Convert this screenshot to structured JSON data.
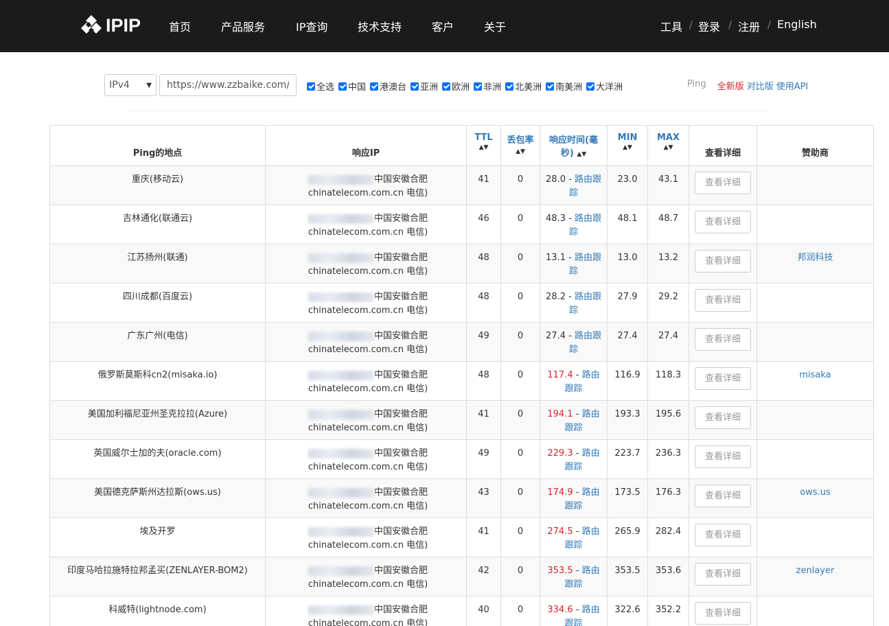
{
  "header": {
    "logo_text": "IPIP",
    "nav": [
      "首页",
      "产品服务",
      "IP查询",
      "技术支持",
      "客户",
      "关于"
    ],
    "right_nav": [
      "工具",
      "登录",
      "注册",
      "English"
    ]
  },
  "toolbar": {
    "ip_version": "IPv4",
    "url_value": "https://www.zzbaike.com/",
    "regions": [
      "全选",
      "中国",
      "港澳台",
      "亚洲",
      "欧洲",
      "非洲",
      "北美洲",
      "南美洲",
      "大洋洲"
    ],
    "ping_label": "Ping",
    "new_version": "全新版",
    "compare_version": "对比版",
    "use_api": "使用API"
  },
  "table": {
    "headers": {
      "location": "Ping的地点",
      "ip": "响应IP",
      "ttl": "TTL",
      "loss": "丢包率",
      "rt": "响应时间(毫秒)",
      "min": "MIN",
      "max": "MAX",
      "detail": "查看详细",
      "sponsor": "赞助商"
    },
    "route_label": "路由跟踪",
    "detail_button": "查看详细",
    "ip_geo": "中国安徽合肥",
    "ip_isp": "chinatelecom.com.cn 电信)",
    "rows": [
      {
        "location": "重庆(移动云)",
        "ttl": "41",
        "loss": "0",
        "rt": "28.0",
        "rt_color": "normal",
        "min": "23.0",
        "max": "43.1",
        "sponsor": ""
      },
      {
        "location": "吉林通化(联通云)",
        "ttl": "46",
        "loss": "0",
        "rt": "48.3",
        "rt_color": "normal",
        "min": "48.1",
        "max": "48.7",
        "sponsor": ""
      },
      {
        "location": "江苏扬州(联通)",
        "ttl": "48",
        "loss": "0",
        "rt": "13.1",
        "rt_color": "normal",
        "min": "13.0",
        "max": "13.2",
        "sponsor": "邦润科技"
      },
      {
        "location": "四川成都(百度云)",
        "ttl": "48",
        "loss": "0",
        "rt": "28.2",
        "rt_color": "normal",
        "min": "27.9",
        "max": "29.2",
        "sponsor": ""
      },
      {
        "location": "广东广州(电信)",
        "ttl": "49",
        "loss": "0",
        "rt": "27.4",
        "rt_color": "normal",
        "min": "27.4",
        "max": "27.4",
        "sponsor": ""
      },
      {
        "location": "俄罗斯莫斯科cn2(misaka.io)",
        "ttl": "48",
        "loss": "0",
        "rt": "117.4",
        "rt_color": "red",
        "min": "116.9",
        "max": "118.3",
        "sponsor": "misaka"
      },
      {
        "location": "美国加利福尼亚州圣克拉拉(Azure)",
        "ttl": "41",
        "loss": "0",
        "rt": "194.1",
        "rt_color": "red",
        "min": "193.3",
        "max": "195.6",
        "sponsor": ""
      },
      {
        "location": "英国威尔士加的夫(oracle.com)",
        "ttl": "49",
        "loss": "0",
        "rt": "229.3",
        "rt_color": "red",
        "min": "223.7",
        "max": "236.3",
        "sponsor": ""
      },
      {
        "location": "美国德克萨斯州达拉斯(ows.us)",
        "ttl": "43",
        "loss": "0",
        "rt": "174.9",
        "rt_color": "red",
        "min": "173.5",
        "max": "176.3",
        "sponsor": "ows.us"
      },
      {
        "location": "埃及开罗",
        "ttl": "41",
        "loss": "0",
        "rt": "274.5",
        "rt_color": "red",
        "min": "265.9",
        "max": "282.4",
        "sponsor": ""
      },
      {
        "location": "印度马哈拉施特拉邦孟买(ZENLAYER-BOM2)",
        "ttl": "42",
        "loss": "0",
        "rt": "353.5",
        "rt_color": "red",
        "min": "353.5",
        "max": "353.6",
        "sponsor": "zenlayer"
      },
      {
        "location": "科威特(lightnode.com)",
        "ttl": "40",
        "loss": "0",
        "rt": "334.6",
        "rt_color": "red",
        "min": "322.6",
        "max": "352.2",
        "sponsor": ""
      }
    ]
  },
  "colors": {
    "header_bg": "#1b1b1b",
    "link_blue": "#337ab7",
    "highlight_red": "#d9232d",
    "checkbox_blue": "#0d6efd"
  }
}
